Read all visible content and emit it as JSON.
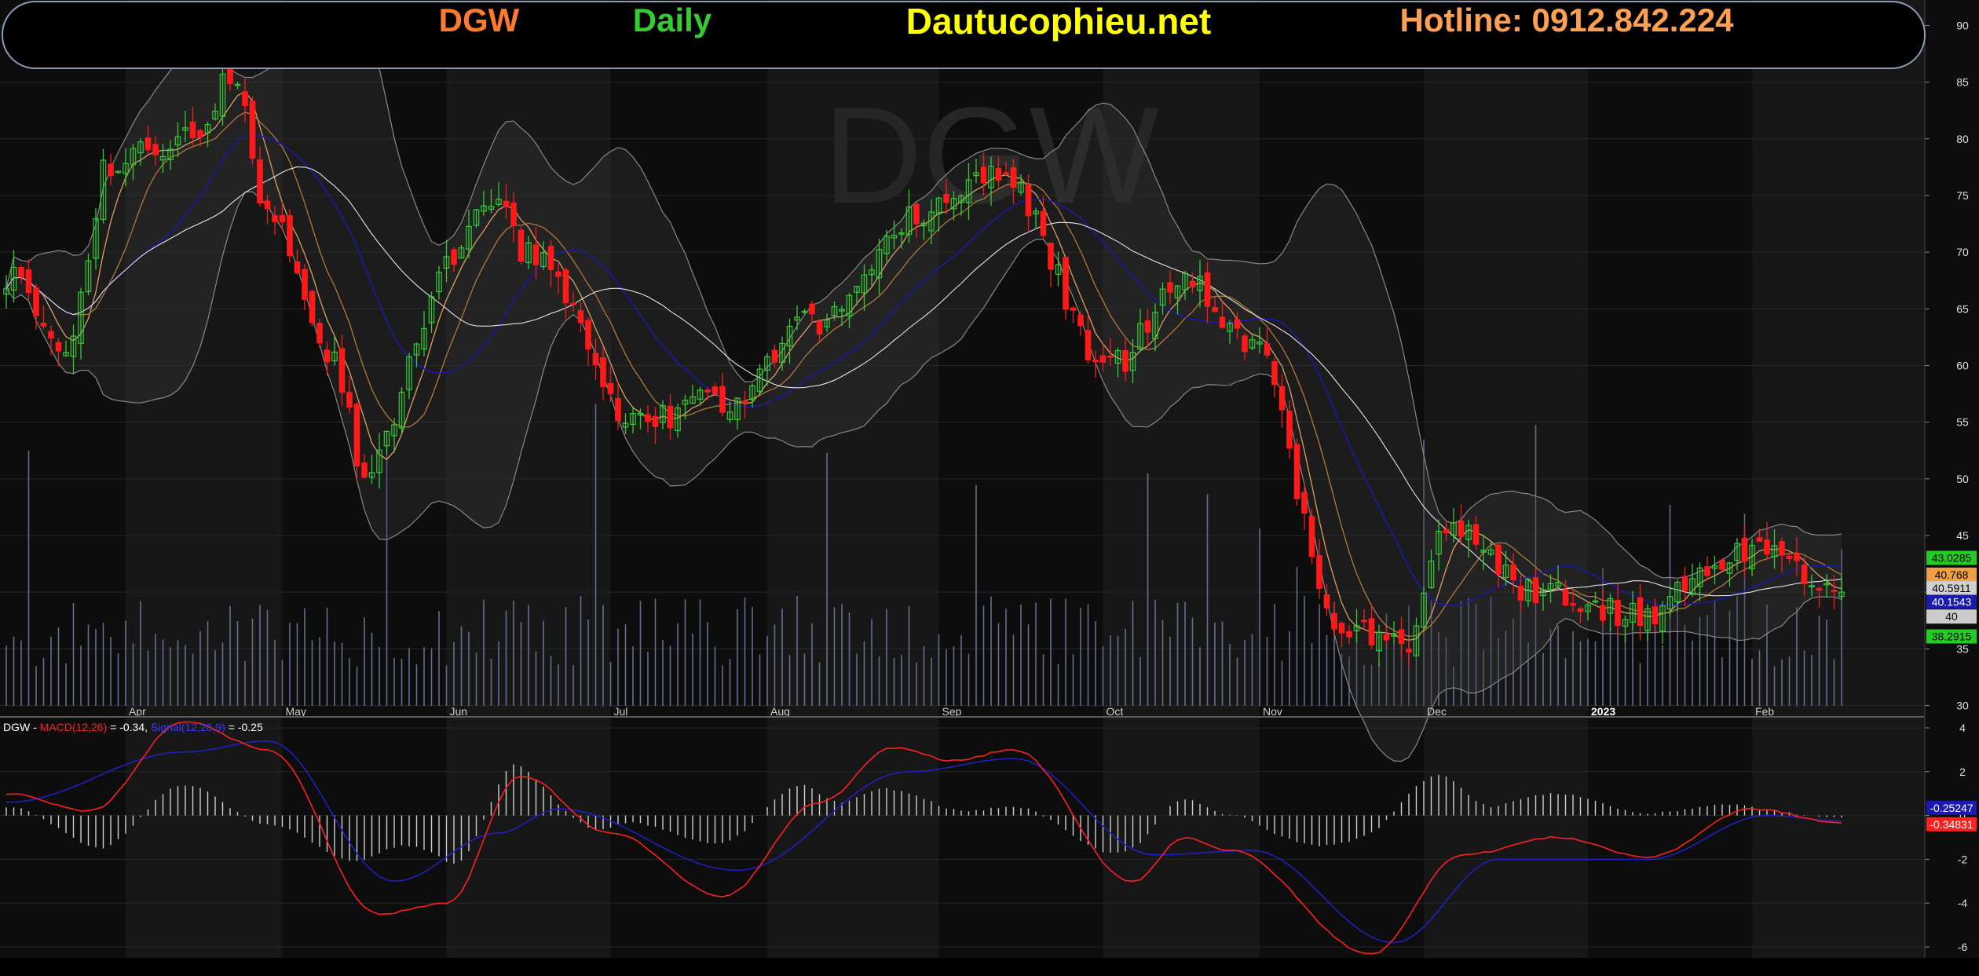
{
  "header": {
    "symbol": "DGW",
    "period": "Daily",
    "site": "Dautucophieu.net",
    "hotline": "Hotline: 0912.842.224"
  },
  "watermark": "DGW",
  "colors": {
    "up": "#33cc33",
    "down": "#ff1a1a",
    "ma_orange": "#d9a066",
    "ma_blue": "#1a1aa8",
    "bb": "#888888",
    "volume": "#6a6a90",
    "macd": "#ff2020",
    "signal": "#2020c0",
    "hist": "#cfcfcf"
  },
  "price_axis_ticks": [
    "90",
    "85",
    "80",
    "75",
    "70",
    "65",
    "60",
    "55",
    "50",
    "45",
    "40",
    "35",
    "30"
  ],
  "macd_axis_ticks": [
    "4",
    "2",
    "0",
    "-2",
    "-4",
    "-6"
  ],
  "month_labels": [
    {
      "label": "Apr",
      "month": "2022-04"
    },
    {
      "label": "May",
      "month": "2022-05"
    },
    {
      "label": "Jun",
      "month": "2022-06"
    },
    {
      "label": "Jul",
      "month": "2022-07"
    },
    {
      "label": "Aug",
      "month": "2022-08"
    },
    {
      "label": "Sep",
      "month": "2022-09"
    },
    {
      "label": "Oct",
      "month": "2022-10"
    },
    {
      "label": "Nov",
      "month": "2022-11"
    },
    {
      "label": "Dec",
      "month": "2022-12"
    },
    {
      "label": "2023",
      "month": "2023-01"
    },
    {
      "label": "Feb",
      "month": "2023-02"
    }
  ],
  "price_tags": [
    {
      "text": "43.0285",
      "price": 43.03,
      "bg": "#22cc22",
      "fg": "#000000"
    },
    {
      "text": "40.768",
      "price": 41.55,
      "bg": "#f0a040",
      "fg": "#000000"
    },
    {
      "text": "40.5911",
      "price": 40.35,
      "bg": "#d0d0d0",
      "fg": "#000000"
    },
    {
      "text": "40.1543",
      "price": 39.15,
      "bg": "#1a1ab0",
      "fg": "#ffffff"
    },
    {
      "text": "40",
      "price": 37.85,
      "bg": "#cccccc",
      "fg": "#000000"
    },
    {
      "text": "38.2915",
      "price": 36.1,
      "bg": "#22cc22",
      "fg": "#000000"
    }
  ],
  "last_price_label": "40",
  "last_price": 40,
  "macd_tags": [
    {
      "text": "-0.25247",
      "value": 0.35,
      "bg": "#1a1ab0",
      "fg": "#ffffff"
    },
    {
      "text": "-0.34831",
      "value": -0.4,
      "bg": "#ff2020",
      "fg": "#ffffff"
    }
  ],
  "macd_legend": {
    "prefix": "DGW - ",
    "macd": "MACD(12,26)",
    "macd_val": " = -0.34, ",
    "signal": "Signal(12,26,9)",
    "signal_val": " = -0.25"
  },
  "chart_data": [
    {
      "type": "candlestick",
      "symbol": "DGW",
      "period": "Daily",
      "y_range": [
        29,
        91
      ],
      "price_ticks": [
        30,
        35,
        40,
        45,
        50,
        55,
        60,
        65,
        70,
        75,
        80,
        85,
        90
      ],
      "keypoints": [
        {
          "date": "2022-03-10",
          "close": 68
        },
        {
          "date": "2022-03-22",
          "close": 62
        },
        {
          "date": "2022-03-30",
          "close": 78
        },
        {
          "date": "2022-04-14",
          "close": 80
        },
        {
          "date": "2022-04-22",
          "close": 86
        },
        {
          "date": "2022-04-28",
          "close": 73
        },
        {
          "date": "2022-05-11",
          "close": 60
        },
        {
          "date": "2022-05-17",
          "close": 51
        },
        {
          "date": "2022-06-02",
          "close": 69
        },
        {
          "date": "2022-06-09",
          "close": 75
        },
        {
          "date": "2022-06-16",
          "close": 70
        },
        {
          "date": "2022-07-07",
          "close": 55
        },
        {
          "date": "2022-07-22",
          "close": 57
        },
        {
          "date": "2022-08-10",
          "close": 64
        },
        {
          "date": "2022-08-26",
          "close": 73
        },
        {
          "date": "2022-09-13",
          "close": 77
        },
        {
          "date": "2022-10-04",
          "close": 60
        },
        {
          "date": "2022-10-18",
          "close": 68
        },
        {
          "date": "2022-10-31",
          "close": 62
        },
        {
          "date": "2022-11-16",
          "close": 37
        },
        {
          "date": "2022-11-28",
          "close": 35
        },
        {
          "date": "2022-12-06",
          "close": 46
        },
        {
          "date": "2022-12-22",
          "close": 40
        },
        {
          "date": "2023-01-10",
          "close": 38
        },
        {
          "date": "2023-02-01",
          "close": 44
        },
        {
          "date": "2023-02-17",
          "close": 40
        }
      ],
      "last_close": 40
    },
    {
      "type": "line",
      "name": "MACD(12,26)",
      "y_range": [
        -6.5,
        4.5
      ],
      "ticks": [
        4,
        2,
        0,
        -2,
        -4,
        -6
      ],
      "macd_keypoints": [
        {
          "date": "2022-03-10",
          "value": 1.0
        },
        {
          "date": "2022-03-25",
          "value": 0.2
        },
        {
          "date": "2022-04-13",
          "value": 4.3
        },
        {
          "date": "2022-04-28",
          "value": 3.0
        },
        {
          "date": "2022-05-19",
          "value": -4.5
        },
        {
          "date": "2022-06-01",
          "value": -4.0
        },
        {
          "date": "2022-06-15",
          "value": 1.8
        },
        {
          "date": "2022-07-01",
          "value": -0.8
        },
        {
          "date": "2022-07-22",
          "value": -3.7
        },
        {
          "date": "2022-08-10",
          "value": 0.6
        },
        {
          "date": "2022-08-24",
          "value": 3.1
        },
        {
          "date": "2022-09-05",
          "value": 2.5
        },
        {
          "date": "2022-09-15",
          "value": 3.0
        },
        {
          "date": "2022-10-07",
          "value": -3.0
        },
        {
          "date": "2022-10-18",
          "value": -1.0
        },
        {
          "date": "2022-10-26",
          "value": -1.6
        },
        {
          "date": "2022-11-22",
          "value": -6.3
        },
        {
          "date": "2022-12-08",
          "value": -1.8
        },
        {
          "date": "2022-12-27",
          "value": -1.0
        },
        {
          "date": "2023-01-12",
          "value": -1.9
        },
        {
          "date": "2023-02-01",
          "value": 0.3
        },
        {
          "date": "2023-02-17",
          "value": -0.34
        }
      ],
      "signal_keypoints": [
        {
          "date": "2022-03-10",
          "value": 0.6
        },
        {
          "date": "2022-04-13",
          "value": 2.9
        },
        {
          "date": "2022-04-28",
          "value": 3.4
        },
        {
          "date": "2022-05-23",
          "value": -3.0
        },
        {
          "date": "2022-06-10",
          "value": -0.8
        },
        {
          "date": "2022-06-22",
          "value": 0.3
        },
        {
          "date": "2022-07-26",
          "value": -2.5
        },
        {
          "date": "2022-08-26",
          "value": 2.0
        },
        {
          "date": "2022-09-15",
          "value": 2.6
        },
        {
          "date": "2022-10-12",
          "value": -1.8
        },
        {
          "date": "2022-10-31",
          "value": -1.6
        },
        {
          "date": "2022-11-25",
          "value": -5.8
        },
        {
          "date": "2022-12-15",
          "value": -2.0
        },
        {
          "date": "2023-01-12",
          "value": -2.0
        },
        {
          "date": "2023-02-03",
          "value": 0.0
        },
        {
          "date": "2023-02-17",
          "value": -0.25
        }
      ],
      "last_macd": -0.34,
      "last_signal": -0.25
    }
  ]
}
